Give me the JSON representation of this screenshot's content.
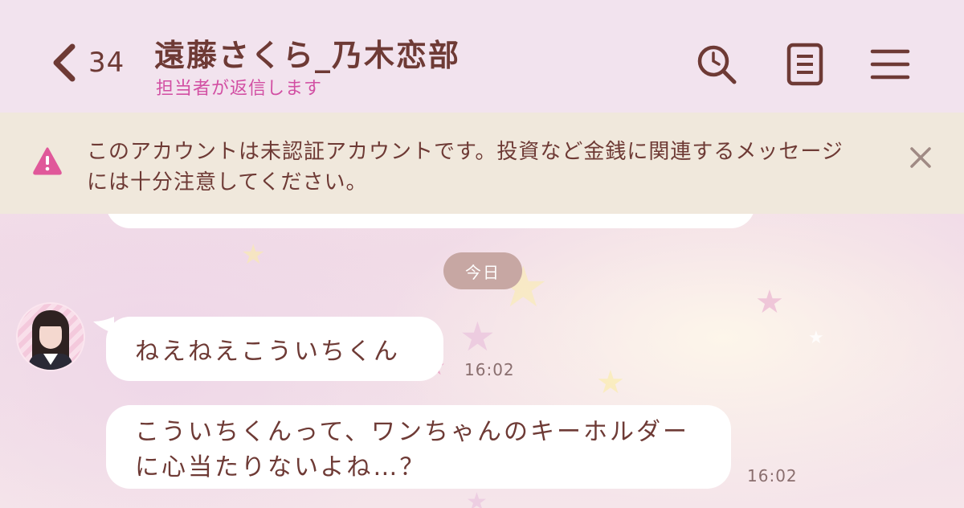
{
  "header": {
    "back_count": "34",
    "title": "遠藤さくら_乃木恋部",
    "subtitle": "担当者が返信します",
    "icons": [
      "search-icon",
      "notes-icon",
      "menu-icon"
    ]
  },
  "banner": {
    "text": "このアカウントは未認証アカウントです。投資など金銭に関連するメッセージには十分注意してください。",
    "icon": "warning-icon",
    "close_icon": "close-icon"
  },
  "chat": {
    "date_label": "今日",
    "messages": [
      {
        "text": "ねえねえこういちくん",
        "time": "16:02"
      },
      {
        "text": "こういちくんって、ワンちゃんのキーホルダーに心当たりないよね…？",
        "time": "16:02"
      }
    ]
  },
  "colors": {
    "header_bg": "#f2e3ee",
    "title": "#6e3a35",
    "subtitle": "#d24fa3",
    "banner_bg": "#f0e8dc",
    "warning": "#e0589a",
    "date_pill": "#c7a7a3"
  }
}
